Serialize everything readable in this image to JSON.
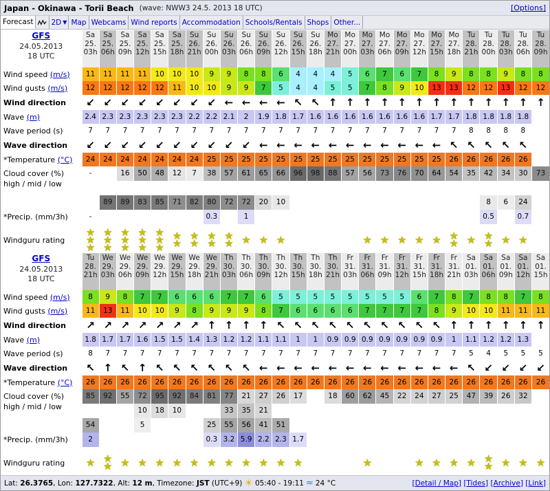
{
  "title": "Japan - Okinawa - Torii Beach",
  "wave_model": "(wave: NWW3 24.5. 2013 18 UTC)",
  "options_link": "[Options]",
  "tabs": [
    "Forecast",
    "2D",
    "Map",
    "Webcams",
    "Wind reports",
    "Accommodation",
    "Schools/Rentals",
    "Shops",
    "Other..."
  ],
  "model": {
    "name": "GFS",
    "date": "24.05.2013",
    "run": "18 UTC"
  },
  "row_labels": {
    "wind_speed": "Wind speed",
    "wind_gusts": "Wind gusts",
    "unit_ms": "(m/s)",
    "wind_direction": "Wind direction",
    "wave": "Wave",
    "unit_m": "(m)",
    "wave_period": "Wave period (s)",
    "wave_direction": "Wave direction",
    "temperature": "*Temperature",
    "unit_c": "(°C)",
    "cloud_cover": "Cloud cover (%)",
    "cloud_levels": "high / mid / low",
    "precip": "*Precip. (mm/3h)",
    "rating": "Windguru rating"
  },
  "panels": [
    {
      "days": [
        "Sa",
        "Sa",
        "Sa",
        "Sa",
        "Sa",
        "Sa",
        "Su",
        "Su",
        "Su",
        "Su",
        "Su",
        "Su",
        "Su",
        "Su",
        "Mo",
        "Mo",
        "Mo",
        "Mo",
        "Mo",
        "Mo",
        "Mo",
        "Mo",
        "Tu",
        "Tu",
        "Tu",
        "Tu",
        "Tu"
      ],
      "dates": [
        "25.",
        "25.",
        "25.",
        "25.",
        "25.",
        "25.",
        "26.",
        "26.",
        "26.",
        "26.",
        "26.",
        "26.",
        "26.",
        "26.",
        "27.",
        "27.",
        "27.",
        "27.",
        "27.",
        "27.",
        "27.",
        "27.",
        "28.",
        "28.",
        "28.",
        "28.",
        "28."
      ],
      "hours": [
        "03h",
        "06h",
        "09h",
        "12h",
        "15h",
        "18h",
        "21h",
        "00h",
        "03h",
        "06h",
        "09h",
        "12h",
        "15h",
        "18h",
        "21h",
        "00h",
        "03h",
        "06h",
        "09h",
        "12h",
        "15h",
        "18h",
        "21h",
        "00h",
        "03h",
        "06h",
        "09h"
      ],
      "hours_display": [
        "03h",
        "06h",
        "09h",
        "12h",
        "15h",
        "18h",
        "21h",
        "03h",
        "06h",
        "09h",
        "12h",
        "15h",
        "18h",
        "21h",
        "00h",
        "03h",
        "06h",
        "09h",
        "12h",
        "15h",
        "18h",
        "21h",
        "00h",
        "03h",
        "06h",
        "09h",
        "12h"
      ],
      "wind_speed": [
        11,
        11,
        11,
        11,
        10,
        10,
        10,
        9,
        9,
        8,
        8,
        6,
        4,
        4,
        4,
        5,
        6,
        7,
        6,
        7,
        8,
        9,
        8,
        8,
        9,
        8,
        8
      ],
      "wind_gusts": [
        12,
        12,
        12,
        12,
        12,
        11,
        10,
        10,
        9,
        9,
        7,
        5,
        4,
        4,
        5,
        5,
        7,
        8,
        9,
        10,
        13,
        13,
        12,
        12,
        13,
        12,
        12
      ],
      "wind_dir": [
        "↙",
        "↙",
        "↙",
        "↙",
        "↙",
        "↙",
        "↙",
        "↙",
        "←",
        "←",
        "←",
        "←",
        "↖",
        "↖",
        "↑",
        "↑",
        "↑",
        "↑",
        "↑",
        "↑",
        "↑",
        "↑",
        "↑",
        "↑",
        "↑",
        "↑",
        "↑"
      ],
      "wave": [
        "2.4",
        "2.3",
        "2.3",
        "2.3",
        "2.3",
        "2.3",
        "2.2",
        "2.2",
        "2.1",
        "2",
        "1.9",
        "1.8",
        "1.7",
        "1.6",
        "1.6",
        "1.6",
        "1.6",
        "1.6",
        "1.6",
        "1.6",
        "1.7",
        "1.7",
        "1.8",
        "1.8",
        "1.8",
        "1.8"
      ],
      "wave_period": [
        7,
        7,
        7,
        7,
        7,
        7,
        7,
        7,
        7,
        7,
        7,
        7,
        7,
        7,
        7,
        7,
        7,
        7,
        7,
        7,
        7,
        7,
        8,
        8,
        8,
        8
      ],
      "wave_dir": [
        "↙",
        "↙",
        "↙",
        "↙",
        "↙",
        "↙",
        "↙",
        "↙",
        "↙",
        "↙",
        "←",
        "←",
        "←",
        "←",
        "←",
        "←",
        "←",
        "←",
        "←",
        "←",
        "←",
        "↖",
        "↖",
        "↖",
        "↖",
        "↖"
      ],
      "temperature": [
        24,
        24,
        24,
        24,
        24,
        24,
        24,
        25,
        25,
        25,
        25,
        25,
        25,
        25,
        25,
        25,
        25,
        25,
        25,
        25,
        25,
        26,
        26,
        26,
        26,
        26
      ],
      "cloud_high": [
        "-",
        "",
        "16",
        "50",
        "48",
        "12",
        "7",
        "38",
        "57",
        "61",
        "65",
        "66",
        "96",
        "98",
        "88",
        "57",
        "56",
        "73",
        "76",
        "70",
        "64",
        "54",
        "35",
        "42",
        "34",
        "30",
        "73"
      ],
      "cloud_mid": [
        "",
        "",
        "",
        "",
        "",
        "",
        "",
        "",
        "",
        "",
        "",
        "",
        "",
        "",
        "",
        "",
        "",
        "",
        "",
        "",
        "",
        "",
        "",
        "",
        "",
        "",
        ""
      ],
      "cloud_low": [
        "",
        "89",
        "89",
        "83",
        "85",
        "71",
        "82",
        "80",
        "72",
        "72",
        "20",
        "10",
        "",
        "",
        "",
        "",
        "",
        "",
        "",
        "",
        "",
        "",
        "",
        "8",
        "6",
        "24",
        ""
      ],
      "precip": [
        "-",
        "",
        "",
        "",
        "",
        "",
        "",
        "0.3",
        "",
        "1",
        "",
        "",
        "",
        "",
        "",
        "",
        "",
        "",
        "",
        "",
        "",
        "",
        "",
        "0.5",
        "",
        "0.7",
        ""
      ],
      "rating": [
        3,
        3,
        3,
        3,
        3,
        2,
        2,
        2,
        2,
        1,
        1,
        1,
        0,
        0,
        0,
        0,
        1,
        1,
        1,
        1,
        1,
        2,
        1,
        2,
        1,
        1
      ]
    },
    {
      "days": [
        "Tu",
        "We",
        "We",
        "We",
        "We",
        "We",
        "We",
        "We",
        "Th",
        "Th",
        "Th",
        "Th",
        "Th",
        "Th",
        "Th",
        "Fr",
        "Fr",
        "Fr",
        "Fr",
        "Fr",
        "Fr",
        "Fr",
        "Sa",
        "Sa",
        "Sa",
        "Sa",
        "Sa"
      ],
      "dates": [
        "28.",
        "29.",
        "29.",
        "29.",
        "29.",
        "29.",
        "29.",
        "29.",
        "30.",
        "30.",
        "30.",
        "30.",
        "30.",
        "30.",
        "30.",
        "31.",
        "31.",
        "31.",
        "31.",
        "31.",
        "31.",
        "31.",
        "01.",
        "01.",
        "01.",
        "01.",
        "01."
      ],
      "hours": [
        "21h",
        "03h",
        "06h",
        "09h",
        "12h",
        "15h",
        "18h",
        "21h",
        "03h",
        "06h",
        "09h",
        "12h",
        "15h",
        "18h",
        "21h",
        "03h",
        "06h",
        "09h",
        "12h",
        "15h",
        "18h",
        "21h",
        "03h",
        "06h",
        "09h",
        "12h",
        "15h"
      ],
      "wind_speed": [
        8,
        9,
        8,
        7,
        7,
        6,
        6,
        6,
        7,
        7,
        6,
        5,
        5,
        5,
        5,
        5,
        5,
        5,
        5,
        6,
        7,
        8,
        7,
        8,
        8,
        7,
        8
      ],
      "wind_gusts": [
        11,
        13,
        11,
        10,
        10,
        9,
        8,
        9,
        9,
        9,
        8,
        7,
        6,
        6,
        6,
        6,
        7,
        7,
        7,
        7,
        8,
        9,
        10,
        10,
        11,
        11,
        11
      ],
      "wind_dir": [
        "↗",
        "↗",
        "↗",
        "↗",
        "↗",
        "↗",
        "↗",
        "↑",
        "↑",
        "↑",
        "↑",
        "↖",
        "↖",
        "↖",
        "↖",
        "↖",
        "↖",
        "↖",
        "↖",
        "↖",
        "↖",
        "↑",
        "↑",
        "↑",
        "↑",
        "↑",
        "↑"
      ],
      "wave": [
        "1.8",
        "1.7",
        "1.7",
        "1.6",
        "1.5",
        "1.5",
        "1.4",
        "1.3",
        "1.2",
        "1.2",
        "1.1",
        "1.1",
        "1",
        "1",
        "0.9",
        "0.9",
        "0.9",
        "0.9",
        "0.9",
        "0.9",
        "0.9",
        "1",
        "1.1",
        "1.2",
        "1.2",
        "1.3"
      ],
      "wave_period": [
        8,
        7,
        7,
        7,
        7,
        7,
        7,
        7,
        7,
        7,
        7,
        7,
        7,
        7,
        7,
        7,
        7,
        7,
        7,
        7,
        7,
        7,
        5,
        4,
        5,
        5,
        5
      ],
      "wave_dir": [
        "↖",
        "↑",
        "↖",
        "↑",
        "↖",
        "↖",
        "↖",
        "↖",
        "↖",
        "↖",
        "←",
        "←",
        "←",
        "←",
        "←",
        "←",
        "←",
        "←",
        "←",
        "←",
        "←",
        "←",
        "↖",
        "↙",
        "↙",
        "↙",
        "↙"
      ],
      "temperature": [
        26,
        26,
        26,
        26,
        26,
        26,
        26,
        26,
        26,
        26,
        26,
        26,
        26,
        26,
        26,
        26,
        26,
        26,
        26,
        26,
        26,
        26,
        26,
        26,
        26,
        26,
        26
      ],
      "cloud_high": [
        "85",
        "92",
        "55",
        "72",
        "95",
        "92",
        "84",
        "81",
        "77",
        "21",
        "27",
        "26",
        "17",
        "",
        "18",
        "60",
        "62",
        "45",
        "22",
        "24",
        "27",
        "25",
        "47",
        "39",
        "26",
        "32",
        ""
      ],
      "cloud_mid": [
        "",
        "",
        "",
        "10",
        "18",
        "10",
        "",
        "",
        "33",
        "35",
        "21",
        "",
        "",
        "",
        "",
        "",
        "",
        "",
        "",
        "",
        "",
        "",
        "",
        "",
        "",
        "",
        ""
      ],
      "cloud_low": [
        "54",
        "",
        "",
        "5",
        "",
        "",
        "",
        "25",
        "55",
        "56",
        "41",
        "51",
        "",
        "",
        "",
        "",
        "",
        "",
        "",
        "",
        "",
        "",
        "",
        "",
        "",
        "",
        ""
      ],
      "precip": [
        "2",
        "",
        "",
        "",
        "",
        "",
        "",
        "0.3",
        "3.2",
        "5.9",
        "2.2",
        "2.3",
        "1.7",
        "",
        "",
        "",
        "",
        "",
        "",
        "",
        "",
        "",
        "",
        "",
        "",
        "",
        ""
      ],
      "rating": [
        1,
        2,
        1,
        1,
        1,
        1,
        1,
        1,
        1,
        1,
        1,
        1,
        1,
        0,
        0,
        0,
        1,
        0,
        0,
        1,
        1,
        1,
        1,
        2,
        1,
        1,
        1
      ]
    }
  ],
  "footer": {
    "lat_label": "Lat:",
    "lat": "26.3765",
    "lon_label": "Lon:",
    "lon": "127.7322",
    "alt_label": "Alt:",
    "alt": "12 m",
    "tz_label": "Timezone:",
    "tz": "JST",
    "tz_offset": "(UTC+9)",
    "sun": "05:40 - 19:11",
    "sea_temp": "24 °C",
    "links": [
      "[Detail / Map]",
      "[Tides]",
      "[Archive]",
      "[Link]"
    ]
  }
}
